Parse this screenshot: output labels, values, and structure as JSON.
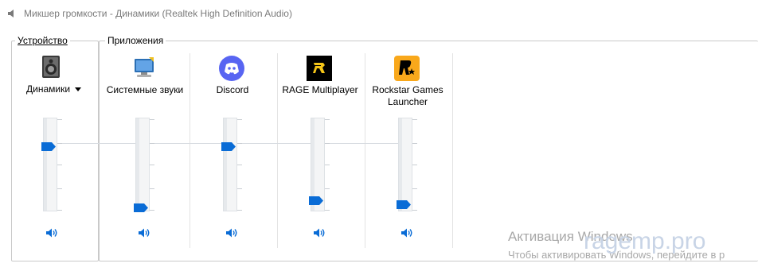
{
  "window": {
    "title": "Микшер громкости - Динамики (Realtek High Definition Audio)"
  },
  "groups": {
    "device_label": "Устройство",
    "apps_label": "Приложения"
  },
  "device": {
    "name": "Динамики",
    "icon": "speaker-device-icon",
    "volume_fraction": 0.72
  },
  "apps": [
    {
      "label": "Системные звуки",
      "icon": "system-sounds-icon",
      "volume_fraction": 0.0
    },
    {
      "label": "Discord",
      "icon": "discord-icon",
      "volume_fraction": 0.72
    },
    {
      "label": "RAGE Multiplayer",
      "icon": "rage-mp-icon",
      "volume_fraction": 0.08
    },
    {
      "label": "Rockstar Games Launcher",
      "label_line1": "Rockstar Games",
      "label_line2": "Launcher",
      "icon": "rockstar-icon",
      "volume_fraction": 0.04
    }
  ],
  "activation": {
    "title": "Активация Windows",
    "subtitle": "Чтобы активировать Windows, перейдите в р"
  },
  "watermark": "ragemp.pro",
  "colors": {
    "accent": "#0a6cd6",
    "discord": "#5865f2",
    "rockstar": "#f9a81b",
    "rage": "#000000"
  }
}
